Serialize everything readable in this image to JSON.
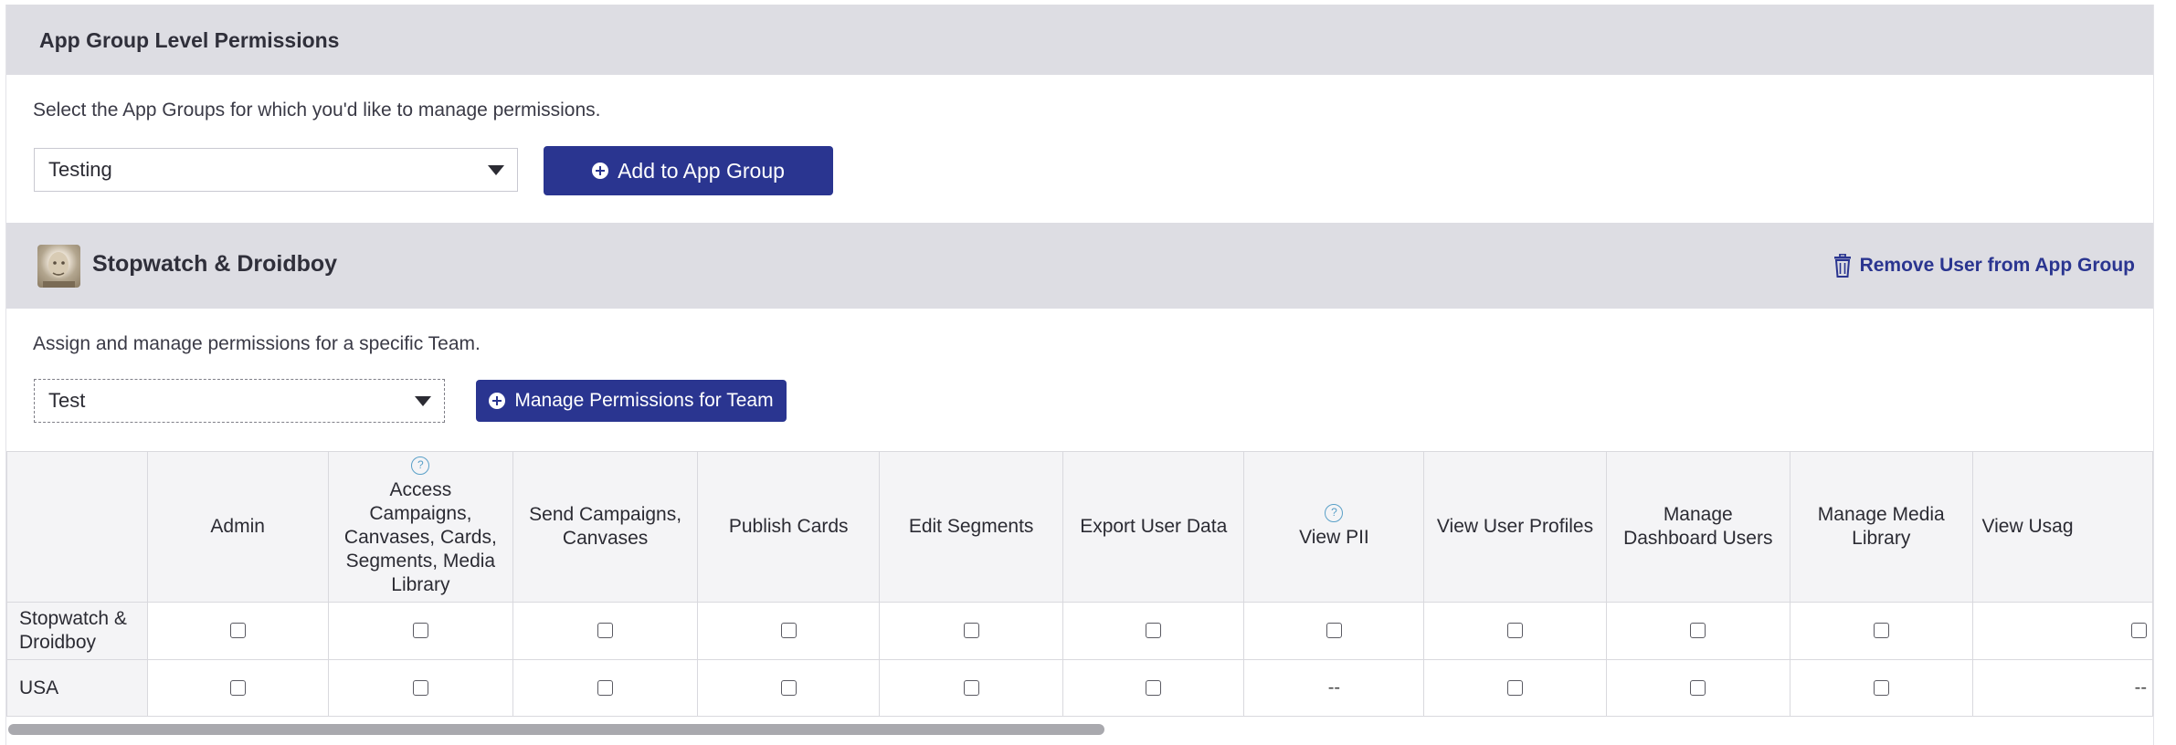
{
  "section": {
    "title": "App Group Level Permissions",
    "helper": "Select the App Groups for which you'd like to manage permissions.",
    "app_group_select": "Testing",
    "add_button": "Add to App Group"
  },
  "app_group": {
    "name": "Stopwatch & Droidboy",
    "remove_link": "Remove User from App Group",
    "helper": "Assign and manage permissions for a specific Team.",
    "team_select": "Test",
    "manage_button": "Manage Permissions for Team"
  },
  "table": {
    "columns": [
      {
        "label": "Admin",
        "help": false
      },
      {
        "label": "Access Campaigns, Canvases, Cards, Segments, Media Library",
        "help": true
      },
      {
        "label": "Send Campaigns, Canvases",
        "help": false
      },
      {
        "label": "Publish Cards",
        "help": false
      },
      {
        "label": "Edit Segments",
        "help": false
      },
      {
        "label": "Export User Data",
        "help": false
      },
      {
        "label": "View PII",
        "help": true
      },
      {
        "label": "View User Profiles",
        "help": false
      },
      {
        "label": "Manage Dashboard Users",
        "help": false
      },
      {
        "label": "Manage Media Library",
        "help": false
      },
      {
        "label": "View Usag",
        "help": false
      }
    ],
    "rows": [
      {
        "label": "Stopwatch & Droidboy",
        "cells": [
          "checkbox",
          "checkbox",
          "checkbox",
          "checkbox",
          "checkbox",
          "checkbox",
          "checkbox",
          "checkbox",
          "checkbox",
          "checkbox",
          "checkbox"
        ]
      },
      {
        "label": "USA",
        "cells": [
          "checkbox",
          "checkbox",
          "checkbox",
          "checkbox",
          "checkbox",
          "checkbox",
          "--",
          "checkbox",
          "checkbox",
          "checkbox",
          "--"
        ]
      }
    ]
  },
  "colors": {
    "primary": "#2a3590",
    "header_band": "#dddde3",
    "help_icon": "#5aa0c8"
  },
  "icons": [
    "plus-circle-icon",
    "trash-icon",
    "help-icon",
    "avatar-image"
  ]
}
